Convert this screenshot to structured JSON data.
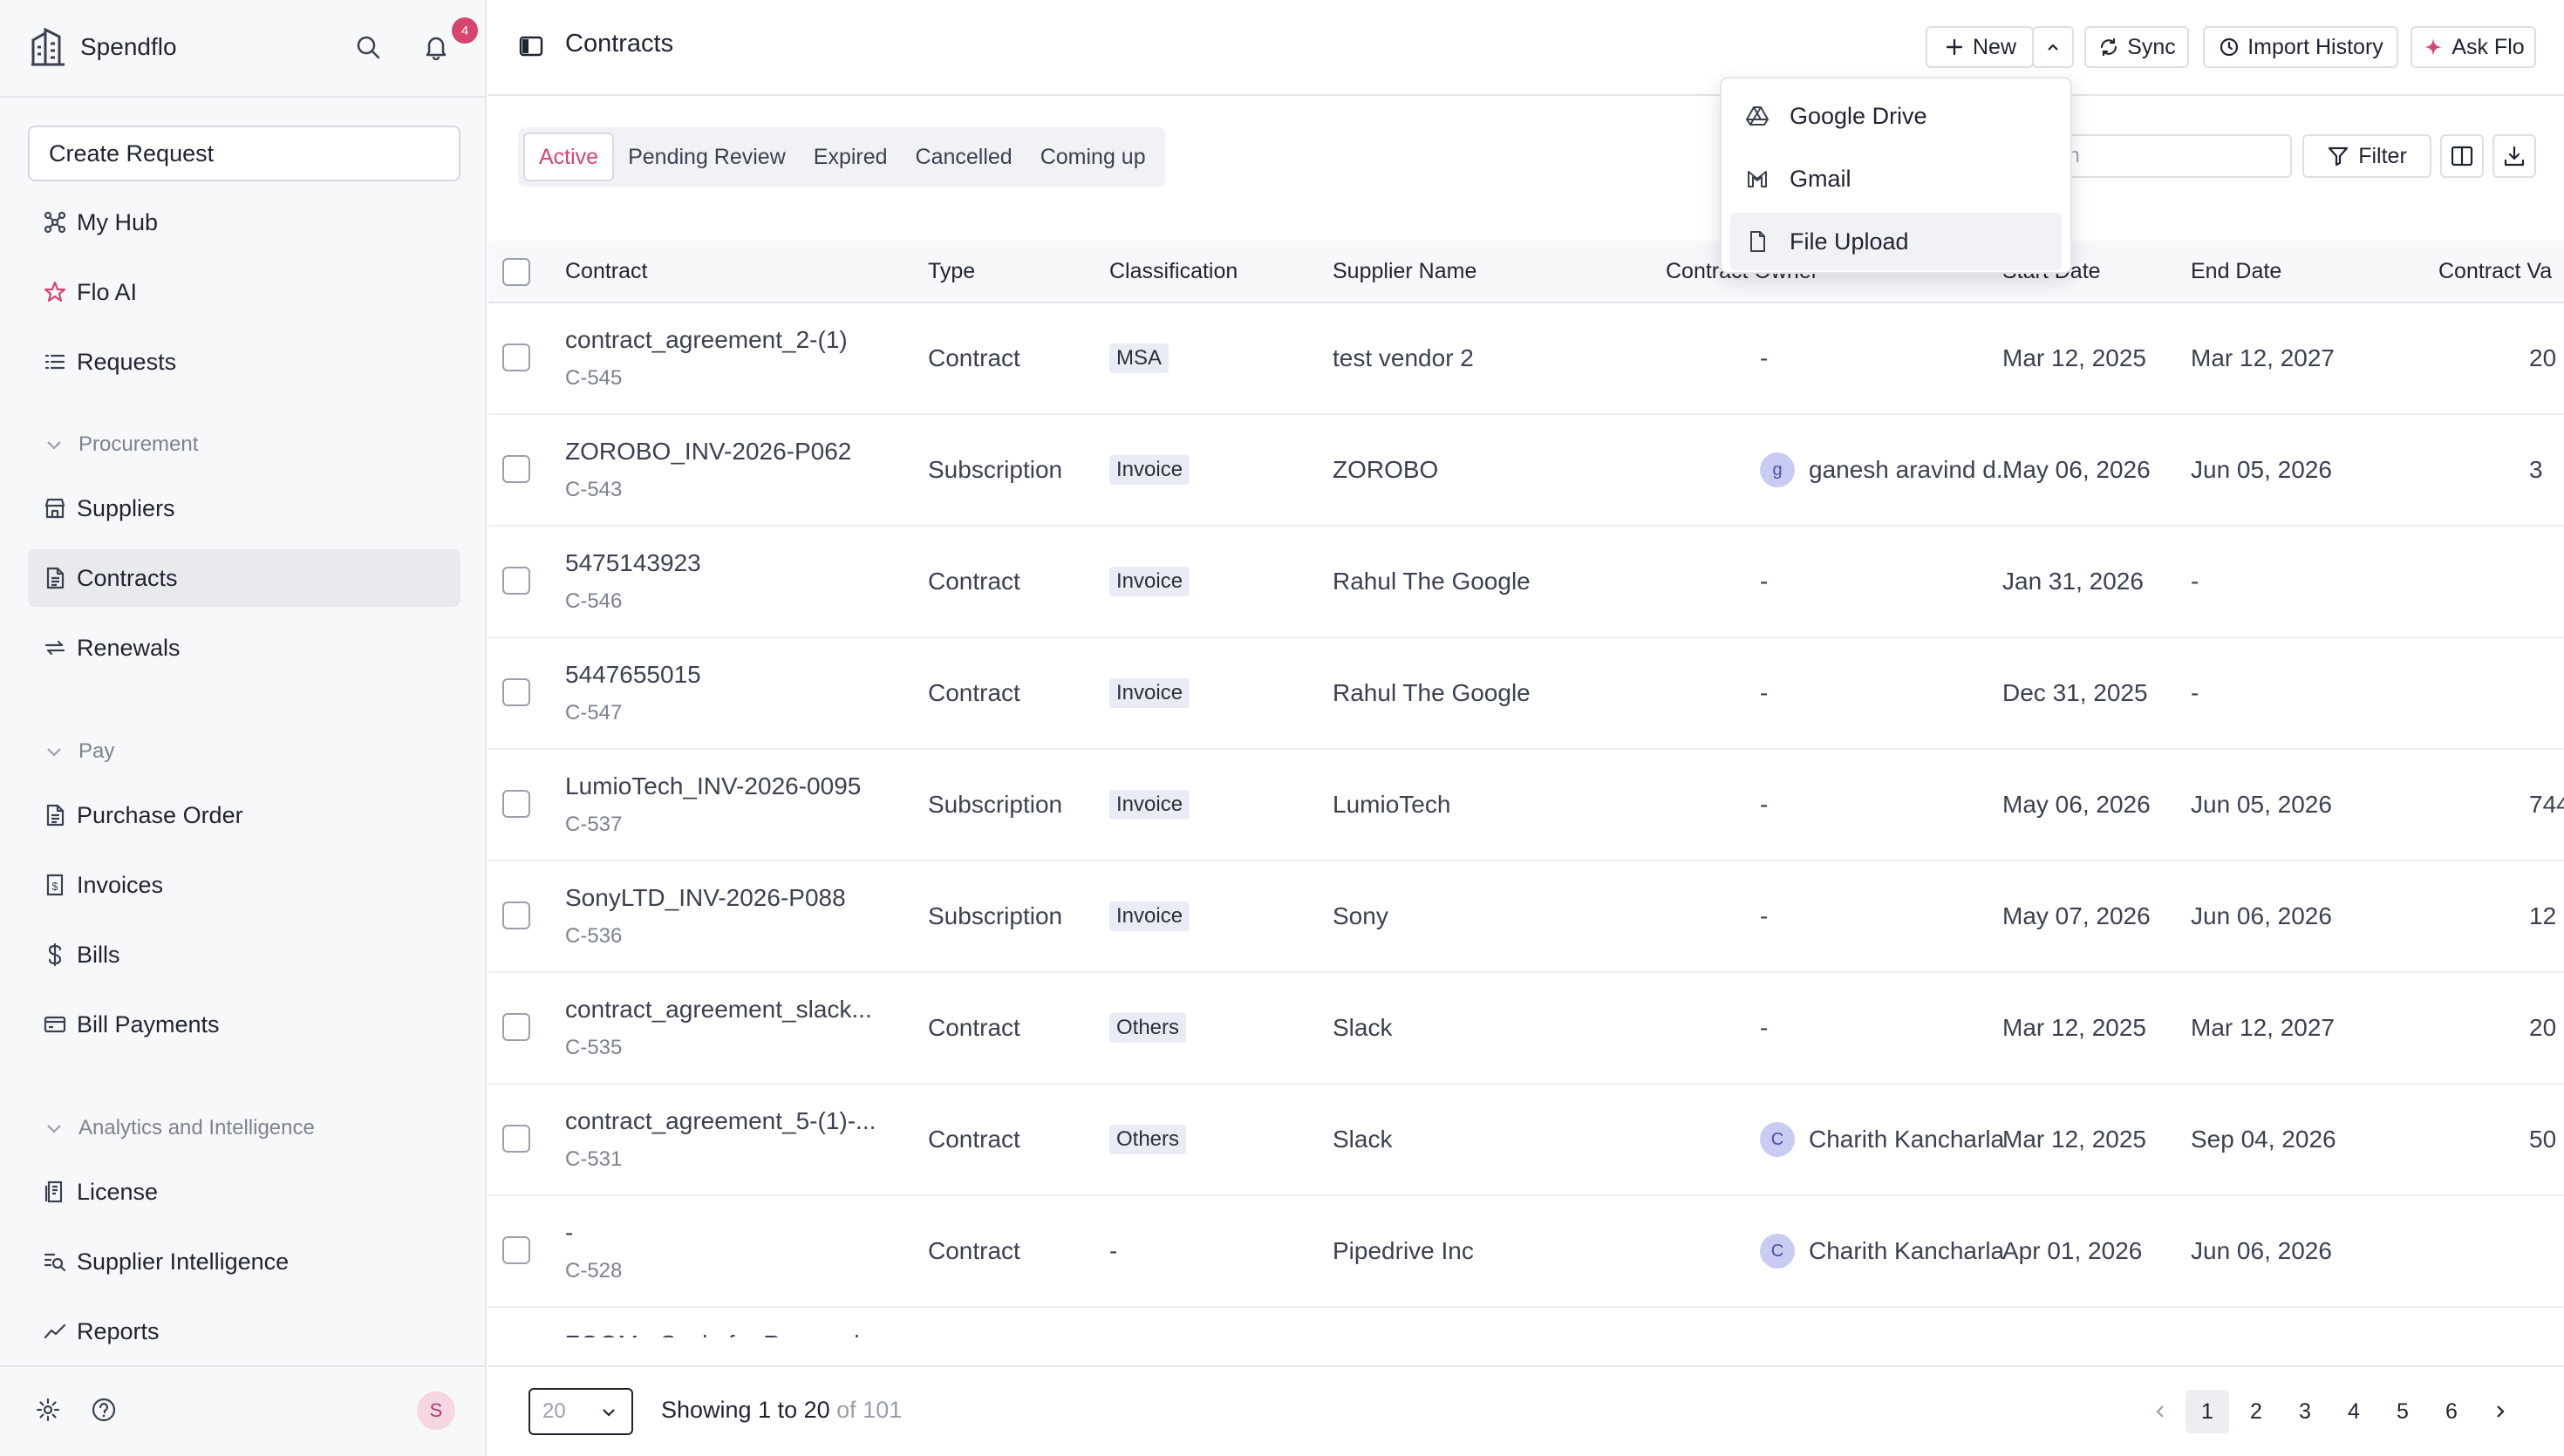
{
  "app": {
    "name": "Spendflo",
    "notification_count": "4",
    "user_initial": "S"
  },
  "sidebar": {
    "create_request": "Create Request",
    "top_items": [
      {
        "label": "My Hub",
        "icon": "hub-icon"
      },
      {
        "label": "Flo AI",
        "icon": "star-icon"
      },
      {
        "label": "Requests",
        "icon": "list-icon"
      }
    ],
    "sections": [
      {
        "title": "Procurement",
        "items": [
          {
            "label": "Suppliers",
            "icon": "store-icon"
          },
          {
            "label": "Contracts",
            "icon": "document-icon",
            "active": true
          },
          {
            "label": "Renewals",
            "icon": "refresh-icon"
          }
        ]
      },
      {
        "title": "Pay",
        "items": [
          {
            "label": "Purchase Order",
            "icon": "document-icon"
          },
          {
            "label": "Invoices",
            "icon": "invoice-icon"
          },
          {
            "label": "Bills",
            "icon": "dollar-icon"
          },
          {
            "label": "Bill Payments",
            "icon": "card-icon"
          }
        ]
      },
      {
        "title": "Analytics and Intelligence",
        "items": [
          {
            "label": "License",
            "icon": "license-icon"
          },
          {
            "label": "Supplier Intelligence",
            "icon": "search-list-icon"
          },
          {
            "label": "Reports",
            "icon": "chart-line-icon"
          }
        ]
      }
    ]
  },
  "header": {
    "title": "Contracts",
    "new_label": "New",
    "sync_label": "Sync",
    "import_history_label": "Import History",
    "ask_flo_label": "Ask Flo"
  },
  "new_menu": {
    "items": [
      {
        "label": "Google Drive",
        "icon": "google-drive-icon"
      },
      {
        "label": "Gmail",
        "icon": "gmail-icon"
      },
      {
        "label": "File Upload",
        "icon": "file-icon",
        "active": true
      }
    ]
  },
  "tabs": [
    {
      "label": "Active",
      "active": true
    },
    {
      "label": "Pending Review"
    },
    {
      "label": "Expired"
    },
    {
      "label": "Cancelled"
    },
    {
      "label": "Coming up"
    }
  ],
  "toolbar": {
    "search_placeholder": "arch",
    "filter_label": "Filter"
  },
  "table": {
    "columns": [
      "Contract",
      "Type",
      "Classification",
      "Supplier Name",
      "Contract Owner",
      "Start Date",
      "End Date",
      "Contract Va"
    ],
    "rows": [
      {
        "name": "contract_agreement_2-(1)",
        "id": "C-545",
        "type": "Contract",
        "classification": "MSA",
        "supplier": "test vendor 2",
        "owner": "-",
        "owner_initial": "",
        "start": "Mar 12, 2025",
        "end": "Mar 12, 2027",
        "value": "20"
      },
      {
        "name": "ZOROBO_INV-2026-P062",
        "id": "C-543",
        "type": "Subscription",
        "classification": "Invoice",
        "supplier": "ZOROBO",
        "owner": "ganesh aravind d...",
        "owner_initial": "g",
        "start": "May 06, 2026",
        "end": "Jun 05, 2026",
        "value": "3"
      },
      {
        "name": "5475143923",
        "id": "C-546",
        "type": "Contract",
        "classification": "Invoice",
        "supplier": "Rahul The Google",
        "owner": "-",
        "owner_initial": "",
        "start": "Jan 31, 2026",
        "end": "-",
        "value": ""
      },
      {
        "name": "5447655015",
        "id": "C-547",
        "type": "Contract",
        "classification": "Invoice",
        "supplier": "Rahul The Google",
        "owner": "-",
        "owner_initial": "",
        "start": "Dec 31, 2025",
        "end": "-",
        "value": ""
      },
      {
        "name": "LumioTech_INV-2026-0095",
        "id": "C-537",
        "type": "Subscription",
        "classification": "Invoice",
        "supplier": "LumioTech",
        "owner": "-",
        "owner_initial": "",
        "start": "May 06, 2026",
        "end": "Jun 05, 2026",
        "value": "744"
      },
      {
        "name": "SonyLTD_INV-2026-P088",
        "id": "C-536",
        "type": "Subscription",
        "classification": "Invoice",
        "supplier": "Sony",
        "owner": "-",
        "owner_initial": "",
        "start": "May 07, 2026",
        "end": "Jun 06, 2026",
        "value": "12"
      },
      {
        "name": "contract_agreement_slack...",
        "id": "C-535",
        "type": "Contract",
        "classification": "Others",
        "supplier": "Slack",
        "owner": "-",
        "owner_initial": "",
        "start": "Mar 12, 2025",
        "end": "Mar 12, 2027",
        "value": "20"
      },
      {
        "name": "contract_agreement_5-(1)-...",
        "id": "C-531",
        "type": "Contract",
        "classification": "Others",
        "supplier": "Slack",
        "owner": "Charith Kancharla",
        "owner_initial": "C",
        "start": "Mar 12, 2025",
        "end": "Sep 04, 2026",
        "value": "50"
      },
      {
        "name": "-",
        "id": "C-528",
        "type": "Contract",
        "classification": "-",
        "supplier": "Pipedrive Inc",
        "owner": "Charith Kancharla",
        "owner_initial": "C",
        "start": "Apr 01, 2026",
        "end": "Jun 06, 2026",
        "value": ""
      },
      {
        "name": "ZOOM - Scale for Research",
        "id": "",
        "type": "",
        "classification": "",
        "supplier": "",
        "owner": "",
        "owner_initial": "",
        "start": "",
        "end": "",
        "value": ""
      }
    ]
  },
  "footer": {
    "page_size": "20",
    "showing_prefix": "Showing 1 to 20",
    "showing_suffix": "of 101",
    "pages": [
      "1",
      "2",
      "3",
      "4",
      "5",
      "6"
    ],
    "current_page": "1"
  }
}
